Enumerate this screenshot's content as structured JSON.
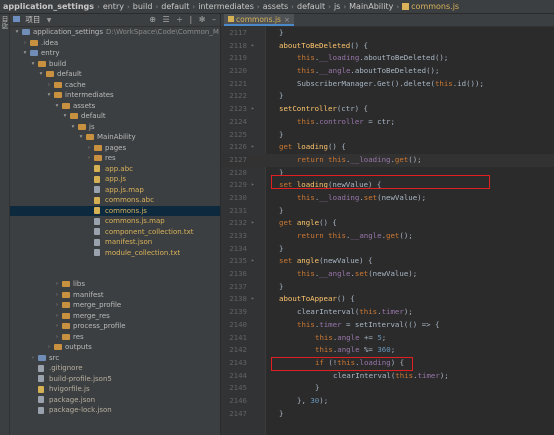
{
  "breadcrumb": [
    {
      "label": "application_settings",
      "first": true
    },
    {
      "label": "entry"
    },
    {
      "label": "build"
    },
    {
      "label": "default"
    },
    {
      "label": "intermediates"
    },
    {
      "label": "assets"
    },
    {
      "label": "default"
    },
    {
      "label": "js"
    },
    {
      "label": "MainAbility"
    },
    {
      "label": "commons.js",
      "active": true
    }
  ],
  "sidestrip_label": "项目",
  "project_panel": {
    "title": "项目",
    "tools": "⊕ ☰ ÷ | ✻ –"
  },
  "tree": [
    {
      "depth": 0,
      "arrow": "▾",
      "icon": "folder-blue",
      "label": "application_settings",
      "path": "D:\\WorkSpace\\Code\\Common_M"
    },
    {
      "depth": 1,
      "arrow": "›",
      "icon": "folder-orange",
      "label": ".idea"
    },
    {
      "depth": 1,
      "arrow": "▾",
      "icon": "folder-blue",
      "label": "entry"
    },
    {
      "depth": 2,
      "arrow": "▾",
      "icon": "folder-orange",
      "label": "build"
    },
    {
      "depth": 3,
      "arrow": "▾",
      "icon": "folder-orange",
      "label": "default"
    },
    {
      "depth": 4,
      "arrow": "›",
      "icon": "folder-orange",
      "label": "cache"
    },
    {
      "depth": 4,
      "arrow": "▾",
      "icon": "folder-orange",
      "label": "intermediates"
    },
    {
      "depth": 5,
      "arrow": "▾",
      "icon": "folder-orange",
      "label": "assets"
    },
    {
      "depth": 6,
      "arrow": "▾",
      "icon": "folder-orange",
      "label": "default"
    },
    {
      "depth": 7,
      "arrow": "▾",
      "icon": "folder-orange",
      "label": "js"
    },
    {
      "depth": 8,
      "arrow": "▾",
      "icon": "folder-orange",
      "label": "MainAbility"
    },
    {
      "depth": 9,
      "arrow": "›",
      "icon": "folder-orange",
      "label": "pages"
    },
    {
      "depth": 9,
      "arrow": "›",
      "icon": "folder-orange",
      "label": "res"
    },
    {
      "depth": 9,
      "arrow": "",
      "icon": "file-js",
      "label": "app.abc",
      "gen": true
    },
    {
      "depth": 9,
      "arrow": "",
      "icon": "file-js",
      "label": "app.js",
      "gen": true
    },
    {
      "depth": 9,
      "arrow": "",
      "icon": "file-gen",
      "label": "app.js.map",
      "gen": true
    },
    {
      "depth": 9,
      "arrow": "",
      "icon": "file-js",
      "label": "commons.abc",
      "gen": true
    },
    {
      "depth": 9,
      "arrow": "",
      "icon": "file-js",
      "label": "commons.js",
      "gen": true,
      "selected": true
    },
    {
      "depth": 9,
      "arrow": "",
      "icon": "file-gen",
      "label": "commons.js.map",
      "gen": true
    },
    {
      "depth": 9,
      "arrow": "",
      "icon": "file-gen",
      "label": "component_collection.txt",
      "gen": true
    },
    {
      "depth": 9,
      "arrow": "",
      "icon": "file-gen",
      "label": "manifest.json",
      "gen": true
    },
    {
      "depth": 9,
      "arrow": "",
      "icon": "file-gen",
      "label": "module_collection.txt",
      "gen": true
    },
    {
      "spacer": true
    },
    {
      "spacer": true
    },
    {
      "depth": 5,
      "arrow": "›",
      "icon": "folder-orange",
      "label": "libs"
    },
    {
      "depth": 5,
      "arrow": "›",
      "icon": "folder-orange",
      "label": "manifest"
    },
    {
      "depth": 5,
      "arrow": "›",
      "icon": "folder-orange",
      "label": "merge_profile"
    },
    {
      "depth": 5,
      "arrow": "›",
      "icon": "folder-orange",
      "label": "merge_res"
    },
    {
      "depth": 5,
      "arrow": "›",
      "icon": "folder-orange",
      "label": "process_profile"
    },
    {
      "depth": 5,
      "arrow": "›",
      "icon": "folder-orange",
      "label": "res"
    },
    {
      "depth": 4,
      "arrow": "›",
      "icon": "folder-orange",
      "label": "outputs"
    },
    {
      "depth": 2,
      "arrow": "›",
      "icon": "folder-blue",
      "label": "src"
    },
    {
      "depth": 2,
      "arrow": "",
      "icon": "file-gen",
      "label": ".gitignore",
      "muted": true
    },
    {
      "depth": 2,
      "arrow": "",
      "icon": "file-gen",
      "label": "build-profile.json5",
      "muted": true
    },
    {
      "depth": 2,
      "arrow": "",
      "icon": "file-js",
      "label": "hvigorfile.js",
      "muted": true
    },
    {
      "depth": 2,
      "arrow": "",
      "icon": "file-gen",
      "label": "package.json",
      "muted": true
    },
    {
      "depth": 2,
      "arrow": "",
      "icon": "file-gen",
      "label": "package-lock.json",
      "muted": true
    }
  ],
  "editor": {
    "tab_label": "commons.js",
    "tab_close": "×",
    "lines": [
      {
        "n": "2117",
        "indent": 1,
        "code": "}"
      },
      {
        "n": "2118",
        "indent": 1,
        "code": "aboutToBeDeleted() {",
        "kind": "method"
      },
      {
        "n": "2119",
        "indent": 2,
        "code": "this.__loading.aboutToBeDeleted();"
      },
      {
        "n": "2120",
        "indent": 2,
        "code": "this.__angle.aboutToBeDeleted();"
      },
      {
        "n": "2121",
        "indent": 2,
        "code": "SubscriberManager.Get().delete(this.id());"
      },
      {
        "n": "2122",
        "indent": 1,
        "code": "}"
      },
      {
        "n": "2123",
        "indent": 1,
        "code": "setController(ctr) {",
        "kind": "method"
      },
      {
        "n": "2124",
        "indent": 2,
        "code": "this.controller = ctr;"
      },
      {
        "n": "2125",
        "indent": 1,
        "code": "}"
      },
      {
        "n": "2126",
        "indent": 1,
        "code": "get loading() {",
        "kind": "getter"
      },
      {
        "n": "2127",
        "indent": 2,
        "code": "return this.__loading.get();",
        "current": true
      },
      {
        "n": "2128",
        "indent": 1,
        "code": "}"
      },
      {
        "n": "2129",
        "indent": 1,
        "code": "set loading(newValue) {",
        "kind": "setter"
      },
      {
        "n": "2130",
        "indent": 2,
        "code": "this.__loading.set(newValue);"
      },
      {
        "n": "2131",
        "indent": 1,
        "code": "}"
      },
      {
        "n": "2132",
        "indent": 1,
        "code": "get angle() {",
        "kind": "getter"
      },
      {
        "n": "2133",
        "indent": 2,
        "code": "return this.__angle.get();"
      },
      {
        "n": "2134",
        "indent": 1,
        "code": "}"
      },
      {
        "n": "2135",
        "indent": 1,
        "code": "set angle(newValue) {",
        "kind": "setter"
      },
      {
        "n": "2136",
        "indent": 2,
        "code": "this.__angle.set(newValue);"
      },
      {
        "n": "2137",
        "indent": 1,
        "code": "}"
      },
      {
        "n": "2138",
        "indent": 1,
        "code": "aboutToAppear() {",
        "kind": "method"
      },
      {
        "n": "2139",
        "indent": 2,
        "code": "clearInterval(this.timer);"
      },
      {
        "n": "2140",
        "indent": 2,
        "code": "this.timer = setInterval(() => {"
      },
      {
        "n": "2141",
        "indent": 3,
        "code": "this.angle += 5;"
      },
      {
        "n": "2142",
        "indent": 3,
        "code": "this.angle %= 360;"
      },
      {
        "n": "2143",
        "indent": 3,
        "code": "if (!this.loading) {"
      },
      {
        "n": "2144",
        "indent": 4,
        "code": "clearInterval(this.timer);"
      },
      {
        "n": "2145",
        "indent": 3,
        "code": "}"
      },
      {
        "n": "2146",
        "indent": 2,
        "code": "}, 30);"
      },
      {
        "n": "2147",
        "indent": 1,
        "code": "}"
      }
    ]
  },
  "colors": {
    "highlight_box": "#e02020",
    "keyword": "#cc7832",
    "method": "#ffc66d",
    "field": "#9876aa",
    "number": "#6897bb"
  }
}
